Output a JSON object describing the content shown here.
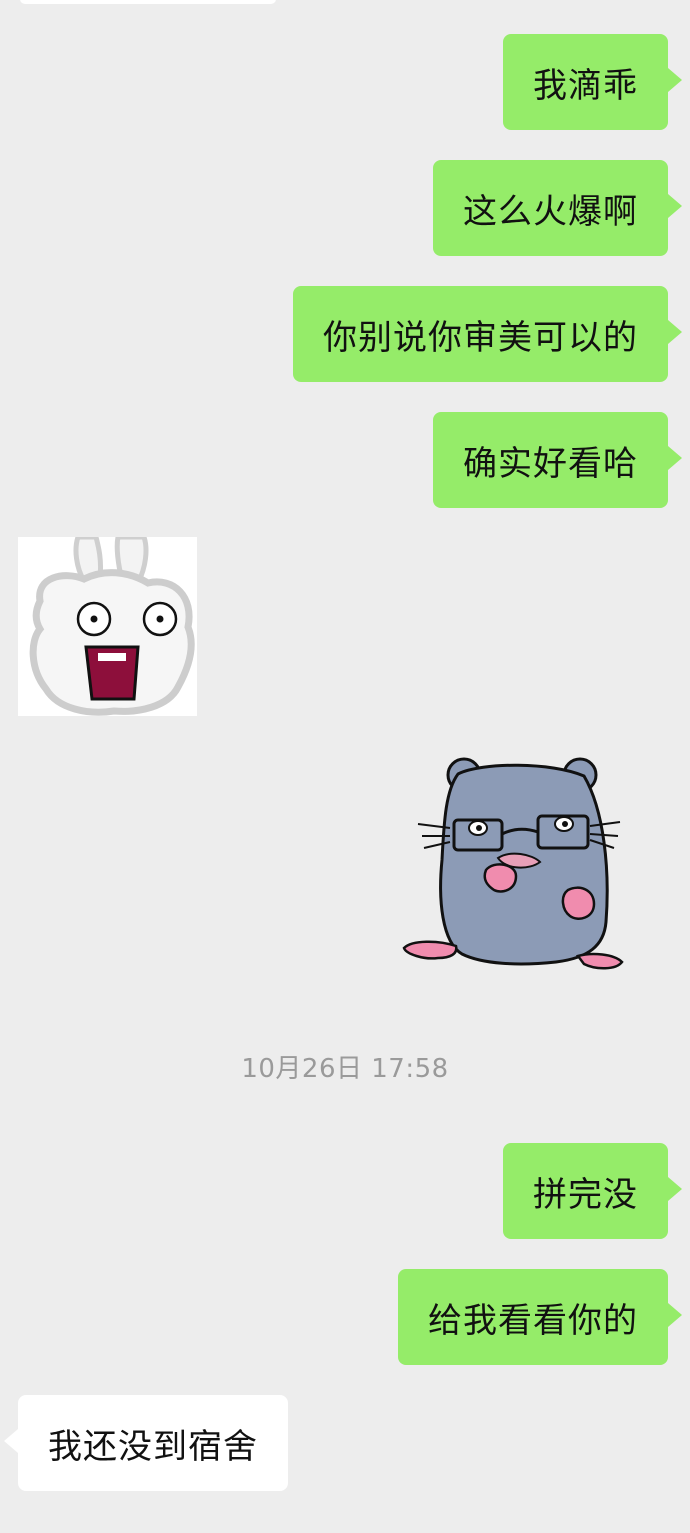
{
  "timestamp": "10月26日 17:58",
  "messages_before": [
    {
      "text": "我滴乖"
    },
    {
      "text": "这么火爆啊"
    },
    {
      "text": "你别说你审美可以的"
    },
    {
      "text": "确实好看哈"
    }
  ],
  "stickers": [
    {
      "icon": "shocked-bunny-sticker-icon",
      "sender": "contact"
    },
    {
      "icon": "hamster-with-glasses-sticker-icon",
      "sender": "me"
    }
  ],
  "messages_after": [
    {
      "text": "拼完没"
    },
    {
      "text": "给我看看你的"
    }
  ],
  "incoming_reply": "我还没到宿舍",
  "colors": {
    "background": "#ededed",
    "outgoing_bubble": "#95ec69",
    "incoming_bubble": "#ffffff",
    "timestamp_text": "#9a9a9a"
  }
}
